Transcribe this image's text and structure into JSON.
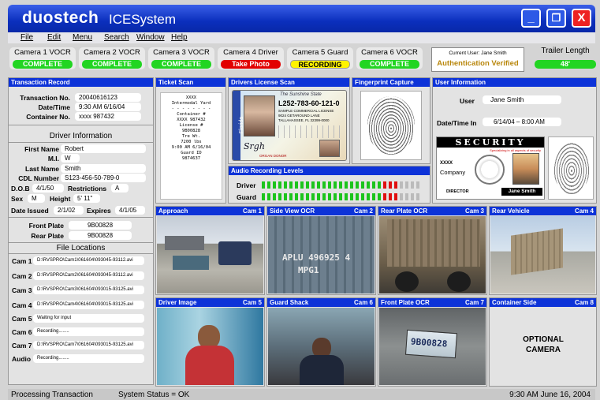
{
  "app": {
    "brand": "duostech",
    "product": "ICESystem",
    "minimize": "_",
    "maximize": "❐",
    "close": "X"
  },
  "menu": [
    "File",
    "Edit",
    "Menu",
    "Search",
    "Window",
    "Help"
  ],
  "cameras": [
    {
      "label": "Camera 1 VOCR",
      "status": "COMPLETE",
      "color": "green"
    },
    {
      "label": "Camera 2 VOCR",
      "status": "COMPLETE",
      "color": "green"
    },
    {
      "label": "Camera 3 VOCR",
      "status": "COMPLETE",
      "color": "green"
    },
    {
      "label": "Camera 4 Driver",
      "status": "Take Photo",
      "color": "red"
    },
    {
      "label": "Camera 5 Guard",
      "status": "RECORDING",
      "color": "yellow"
    },
    {
      "label": "Camera 6 VOCR",
      "status": "COMPLETE",
      "color": "green"
    }
  ],
  "current_user": {
    "label": "Current User: Jane Smith",
    "status": "Authentication Verified"
  },
  "trailer": {
    "label": "Trailer Length",
    "value": "48'"
  },
  "transaction": {
    "title": "Transaction Record",
    "number_label": "Transaction No.",
    "number": "20040616123",
    "datetime_label": "Date/Time",
    "datetime": "9:30 AM 6/16/04",
    "container_label": "Container No.",
    "container": "xxxx 987432"
  },
  "driver": {
    "title": "Driver Information",
    "first_label": "First Name",
    "first": "Robert",
    "mi_label": "M.I.",
    "mi": "W",
    "last_label": "Last Name",
    "last": "Smith",
    "cdl_label": "CDL Number",
    "cdl": "S123-456-50-789-0",
    "dob_label": "D.O.B",
    "dob": "4/1/50",
    "restrictions_label": "Restrictions",
    "restrictions": "A",
    "sex_label": "Sex",
    "sex": "M",
    "height_label": "Height",
    "height": "5' 11\"",
    "issued_label": "Date Issued",
    "issued": "2/1/02",
    "expires_label": "Expires",
    "expires": "4/1/05"
  },
  "plates": {
    "front_label": "Front Plate",
    "front": "9B00828",
    "rear_label": "Rear Plate",
    "rear": "9B00828"
  },
  "files": {
    "title": "File Locations",
    "items": [
      {
        "label": "Cam 1",
        "value": "D:\\RVSPRO\\Cam1\\061604\\093045-93112.avi"
      },
      {
        "label": "Cam 2",
        "value": "D:\\RVSPRO\\Cam2\\061604\\093045-93112.avi"
      },
      {
        "label": "Cam 3",
        "value": "D:\\RVSPRO\\Cam3\\061604\\093015-93125.avi"
      },
      {
        "label": "Cam 4",
        "value": "D:\\RVSPRO\\Cam4\\061604\\093015-93125.avi"
      },
      {
        "label": "Cam 5",
        "value": "Waiting for input"
      },
      {
        "label": "Cam 6",
        "value": "Recording........"
      },
      {
        "label": "Cam 7",
        "value": "D:\\RVSPRO\\Cam7\\061604\\093015-93125.avi"
      },
      {
        "label": "Audio",
        "value": "Recording........"
      }
    ]
  },
  "ticket": {
    "title": "Ticket Scan",
    "lines": [
      "XXXX",
      "Intermodal Yard",
      "- - - - - - - -",
      "Container #",
      "XXXX 987432",
      "",
      "License #",
      "9B00828",
      "",
      "Tre Wt.",
      "7200 lbs",
      "",
      "9:00 AM 6/16/04",
      "",
      "Guard ID",
      "9874637"
    ]
  },
  "license": {
    "title": "Drivers License Scan",
    "state": "The Sunshine State",
    "number": "L252-783-60-121-0",
    "line1": "SAMPLE COMMERCIAL LICENSE",
    "line2": "9024 GETAROUND LANE",
    "line3": "TALLAHASSEE, FL 32399-0000",
    "state_name": "Florida",
    "footer": "ORGAN DONOR"
  },
  "fingerprint": {
    "title": "Fingerprint Capture"
  },
  "user_info": {
    "title": "User Information",
    "user_label": "User",
    "user": "Jane Smith",
    "datetime_label": "Date/Time In",
    "datetime": "6/14/04 – 8:00 AM",
    "badge_title": "SECURITY",
    "badge_tag": "Specializing in all aspects of security",
    "company_code": "XXXX",
    "company": "Company",
    "role": "DIRECTOR",
    "name": "Jane Smith"
  },
  "audio": {
    "title": "Audio Recording Levels",
    "driver_label": "Driver",
    "guard_label": "Guard",
    "driver_level": 0.86,
    "guard_level": 0.86
  },
  "views": [
    {
      "title": "Approach",
      "cam": "Cam 1"
    },
    {
      "title": "Side View OCR",
      "cam": "Cam 2",
      "ocr1": "APLU 496925 4",
      "ocr2": "MPG1"
    },
    {
      "title": "Rear Plate OCR",
      "cam": "Cam 3"
    },
    {
      "title": "Rear Vehicle",
      "cam": "Cam 4"
    },
    {
      "title": "Driver Image",
      "cam": "Cam 5"
    },
    {
      "title": "Guard Shack",
      "cam": "Cam 6"
    },
    {
      "title": "Front Plate OCR",
      "cam": "Cam 7",
      "plate": "9B00828"
    },
    {
      "title": "Container Side",
      "cam": "Cam 8",
      "optional": "OPTIONAL CAMERA"
    }
  ],
  "status": {
    "left": "Processing Transaction",
    "middle": "System Status = OK",
    "right": "9:30 AM  June 16, 2004"
  }
}
